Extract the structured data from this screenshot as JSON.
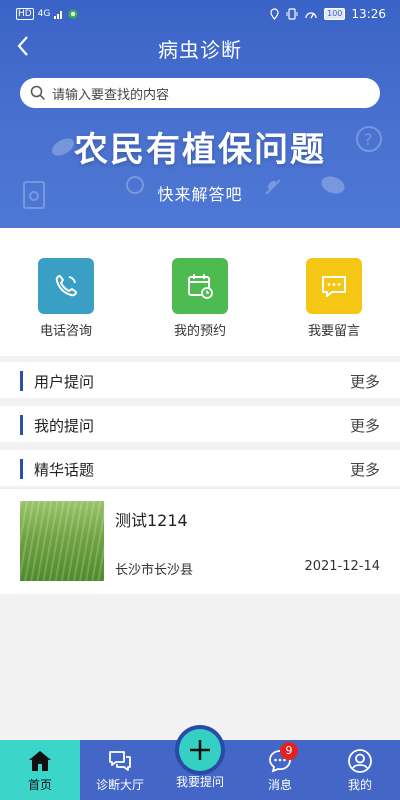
{
  "status_bar": {
    "hd": "HD",
    "net": "4G",
    "time": "13:26",
    "battery": "100"
  },
  "header": {
    "title": "病虫诊断"
  },
  "search": {
    "placeholder": "请输入要查找的内容"
  },
  "banner": {
    "slogan": "农民有植保问题",
    "subtitle": "快来解答吧"
  },
  "quick_actions": [
    {
      "label": "电话咨询",
      "icon": "phone-icon",
      "color": "#3a9fc4"
    },
    {
      "label": "我的预约",
      "icon": "calendar-icon",
      "color": "#4dbb50"
    },
    {
      "label": "我要留言",
      "icon": "chat-bubble-icon",
      "color": "#f6c614"
    }
  ],
  "sections": [
    {
      "label": "用户提问",
      "more": "更多"
    },
    {
      "label": "我的提问",
      "more": "更多"
    },
    {
      "label": "精华话题",
      "more": "更多"
    }
  ],
  "topics": [
    {
      "title": "测试1214",
      "location": "长沙市长沙县",
      "date": "2021-12-14"
    }
  ],
  "tabbar": {
    "tabs": [
      {
        "label": "首页",
        "icon": "home-icon"
      },
      {
        "label": "诊断大厅",
        "icon": "chat-hall-icon"
      },
      {
        "label": "我要提问",
        "icon": "plus-icon"
      },
      {
        "label": "消息",
        "icon": "message-icon",
        "badge": "9"
      },
      {
        "label": "我的",
        "icon": "user-icon"
      }
    ]
  },
  "colors": {
    "primary": "#3a63c7",
    "tab_active": "#3bd6c9",
    "accent_bar": "#2d4fa7",
    "badge": "#e52222"
  }
}
